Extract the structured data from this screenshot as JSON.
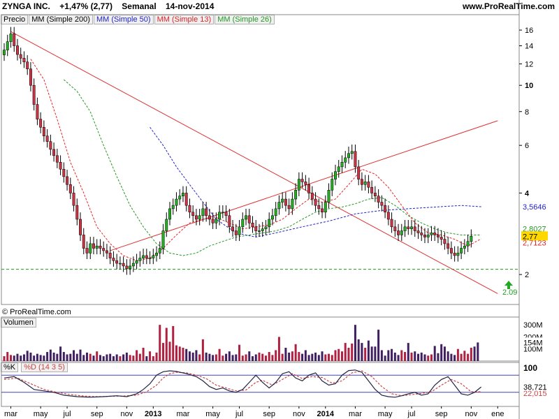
{
  "header": {
    "ticker": "ZYNGA INC.",
    "change": "+1,47% (2,77)",
    "period": "Semanal",
    "date": "14-nov-2014",
    "site": "www.ProRealTime.com"
  },
  "copyright": "© ProRealTime.com",
  "legend": {
    "price": "Precio",
    "ma200": "MM (Simple 200)",
    "ma50": "MM (Simple 50)",
    "ma13": "MM (Simple 13)",
    "ma26": "MM (Simple 26)"
  },
  "volume_title": "Volumen",
  "stoch_titles": {
    "k": "%K",
    "d": "%D (14 3 5)"
  },
  "colors": {
    "up": "#22b022",
    "down": "#cc3344",
    "ma50": "#2222cc",
    "ma13": "#ee2222",
    "ma26": "#229922",
    "trendline": "#dd3333",
    "vol_up": "#b02040",
    "vol_down": "#402060",
    "stoch_k": "#222244",
    "stoch_d": "#cc4444"
  },
  "chart_data": {
    "type": "candlestick",
    "price_axis": {
      "ticks": [
        2,
        4,
        6,
        8,
        10,
        12,
        14,
        16
      ],
      "bold_ticks": [
        10,
        4
      ],
      "scale": "log"
    },
    "price_labels": {
      "last": "2,77",
      "ma50": "3,5646",
      "ma26": "2,8027",
      "ma13": "2,7123",
      "support": "2.09"
    },
    "support_level": 2.09,
    "x_labels": [
      "mar",
      "may",
      "jul",
      "sep",
      "nov",
      "2013",
      "mar",
      "may",
      "jul",
      "sep",
      "nov",
      "2014",
      "mar",
      "may",
      "jul",
      "sep",
      "nov",
      "ene"
    ],
    "x_label_weeks": [
      2,
      11,
      19,
      28,
      37,
      45,
      54,
      63,
      71,
      80,
      89,
      97,
      106,
      115,
      123,
      132,
      141,
      149
    ],
    "start_label": "mar",
    "closes": [
      13.5,
      14.5,
      15.5,
      14,
      13,
      12.6,
      12.2,
      11.5,
      10,
      8.5,
      7.5,
      7,
      6.5,
      6.2,
      5.8,
      5.5,
      5.2,
      4.9,
      4.6,
      4.3,
      4,
      3.6,
      3.2,
      2.8,
      2.5,
      2.4,
      2.6,
      2.5,
      2.55,
      2.5,
      2.45,
      2.4,
      2.3,
      2.25,
      2.2,
      2.2,
      2.15,
      2.1,
      2.15,
      2.2,
      2.25,
      2.3,
      2.35,
      2.3,
      2.3,
      2.35,
      2.4,
      2.5,
      2.9,
      3.2,
      3.5,
      3.6,
      3.8,
      3.9,
      4.0,
      3.6,
      3.4,
      3.3,
      3.2,
      3.3,
      3.5,
      3.3,
      3.2,
      3.1,
      3.2,
      3.4,
      3.4,
      3.3,
      3.0,
      2.9,
      2.8,
      3.0,
      3.2,
      3.3,
      3.1,
      3.0,
      2.9,
      2.9,
      2.95,
      3.0,
      3.2,
      3.3,
      3.5,
      3.7,
      3.8,
      3.6,
      3.5,
      3.8,
      4.1,
      4.5,
      4.4,
      4.3,
      4.0,
      3.8,
      3.6,
      3.5,
      3.4,
      3.7,
      4.1,
      4.5,
      4.8,
      5.0,
      5.2,
      5.4,
      5.6,
      5.7,
      5.0,
      4.5,
      4.3,
      4.4,
      4.2,
      4.0,
      3.9,
      3.7,
      3.6,
      3.4,
      3.2,
      3.0,
      2.9,
      2.8,
      2.9,
      3.0,
      2.95,
      3.0,
      2.9,
      2.85,
      2.8,
      2.75,
      2.8,
      2.85,
      2.8,
      2.75,
      2.7,
      2.6,
      2.5,
      2.4,
      2.35,
      2.4,
      2.5,
      2.55,
      2.65,
      2.77
    ],
    "ma50_label": "MM (Simple 50)",
    "ma50": [
      [
        44,
        7.0
      ],
      [
        48,
        6.0
      ],
      [
        52,
        5.0
      ],
      [
        56,
        4.3
      ],
      [
        60,
        3.7
      ],
      [
        64,
        3.2
      ],
      [
        70,
        2.85
      ],
      [
        76,
        2.75
      ],
      [
        82,
        2.85
      ],
      [
        90,
        3.0
      ],
      [
        98,
        3.15
      ],
      [
        106,
        3.35
      ],
      [
        114,
        3.45
      ],
      [
        122,
        3.5
      ],
      [
        130,
        3.55
      ],
      [
        138,
        3.6
      ],
      [
        144,
        3.56
      ]
    ],
    "ma26_label": "MM (Simple 26)",
    "ma26": [
      [
        18,
        10.5
      ],
      [
        22,
        9.5
      ],
      [
        26,
        8.0
      ],
      [
        30,
        6.0
      ],
      [
        34,
        4.6
      ],
      [
        38,
        3.6
      ],
      [
        42,
        3.0
      ],
      [
        46,
        2.6
      ],
      [
        50,
        2.4
      ],
      [
        54,
        2.35
      ],
      [
        58,
        2.4
      ],
      [
        62,
        2.55
      ],
      [
        66,
        2.65
      ],
      [
        70,
        2.75
      ],
      [
        74,
        2.8
      ],
      [
        78,
        2.85
      ],
      [
        82,
        2.9
      ],
      [
        86,
        3.0
      ],
      [
        90,
        3.2
      ],
      [
        94,
        3.4
      ],
      [
        98,
        3.5
      ],
      [
        102,
        3.55
      ],
      [
        106,
        3.65
      ],
      [
        110,
        3.8
      ],
      [
        114,
        3.85
      ],
      [
        118,
        3.6
      ],
      [
        122,
        3.3
      ],
      [
        126,
        3.1
      ],
      [
        130,
        2.95
      ],
      [
        134,
        2.85
      ],
      [
        138,
        2.8
      ],
      [
        144,
        2.8
      ]
    ],
    "ma13_label": "MM (Simple 13)",
    "ma13": [
      [
        8,
        12.5
      ],
      [
        12,
        10.5
      ],
      [
        16,
        7.5
      ],
      [
        20,
        5.2
      ],
      [
        24,
        4.0
      ],
      [
        28,
        3.0
      ],
      [
        32,
        2.6
      ],
      [
        36,
        2.35
      ],
      [
        40,
        2.25
      ],
      [
        44,
        2.3
      ],
      [
        48,
        2.5
      ],
      [
        52,
        2.8
      ],
      [
        56,
        3.1
      ],
      [
        60,
        3.2
      ],
      [
        64,
        3.25
      ],
      [
        68,
        3.1
      ],
      [
        72,
        2.95
      ],
      [
        76,
        3.0
      ],
      [
        80,
        3.05
      ],
      [
        84,
        3.2
      ],
      [
        88,
        3.5
      ],
      [
        92,
        3.8
      ],
      [
        96,
        3.7
      ],
      [
        100,
        3.8
      ],
      [
        104,
        4.3
      ],
      [
        108,
        4.9
      ],
      [
        112,
        4.7
      ],
      [
        116,
        4.2
      ],
      [
        120,
        3.6
      ],
      [
        124,
        3.1
      ],
      [
        128,
        2.85
      ],
      [
        132,
        2.8
      ],
      [
        136,
        2.7
      ],
      [
        140,
        2.55
      ],
      [
        144,
        2.71
      ]
    ],
    "trendlines": [
      {
        "from": [
          2,
          15.8
        ],
        "to": [
          149,
          1.7
        ]
      },
      {
        "from": [
          32,
          2.45
        ],
        "to": [
          149,
          7.4
        ]
      }
    ],
    "volume_axis": {
      "ticks": [
        "300M",
        "200M",
        "100M"
      ]
    },
    "volume_last_label": "154M",
    "volumes_m": [
      40,
      75,
      50,
      45,
      60,
      45,
      55,
      85,
      70,
      45,
      60,
      50,
      45,
      75,
      95,
      70,
      60,
      120,
      75,
      55,
      60,
      90,
      60,
      95,
      50,
      70,
      60,
      45,
      80,
      50,
      40,
      55,
      60,
      40,
      55,
      40,
      55,
      70,
      50,
      45,
      90,
      60,
      110,
      40,
      80,
      40,
      70,
      300,
      150,
      275,
      160,
      290,
      130,
      120,
      110,
      100,
      80,
      70,
      90,
      55,
      180,
      70,
      60,
      50,
      55,
      100,
      45,
      60,
      80,
      50,
      55,
      135,
      45,
      55,
      80,
      40,
      55,
      70,
      60,
      45,
      75,
      50,
      90,
      200,
      60,
      110,
      70,
      80,
      140,
      75,
      60,
      90,
      50,
      60,
      70,
      50,
      80,
      55,
      60,
      50,
      90,
      100,
      80,
      150,
      110,
      145,
      300,
      180,
      150,
      110,
      170,
      120,
      120,
      260,
      90,
      45,
      90,
      100,
      70,
      50,
      90,
      75,
      150,
      70,
      80,
      60,
      70,
      55,
      45,
      55,
      125,
      65,
      140,
      120,
      80,
      60,
      50,
      100,
      60,
      85,
      60,
      110,
      120,
      154
    ],
    "stoch_axis": {
      "ticks": [
        100
      ]
    },
    "stoch_labels": {
      "k": "38,721",
      "d": "22,015"
    },
    "stoch_levels": [
      80,
      20
    ],
    "stoch_k": [
      [
        0,
        70
      ],
      [
        3,
        75
      ],
      [
        6,
        55
      ],
      [
        9,
        30
      ],
      [
        12,
        25
      ],
      [
        15,
        20
      ],
      [
        18,
        10
      ],
      [
        22,
        5
      ],
      [
        26,
        3
      ],
      [
        30,
        5
      ],
      [
        34,
        8
      ],
      [
        37,
        5
      ],
      [
        40,
        15
      ],
      [
        42,
        30
      ],
      [
        44,
        50
      ],
      [
        46,
        80
      ],
      [
        48,
        92
      ],
      [
        50,
        95
      ],
      [
        52,
        93
      ],
      [
        55,
        85
      ],
      [
        58,
        75
      ],
      [
        60,
        60
      ],
      [
        62,
        40
      ],
      [
        64,
        30
      ],
      [
        66,
        35
      ],
      [
        68,
        25
      ],
      [
        70,
        20
      ],
      [
        72,
        30
      ],
      [
        74,
        55
      ],
      [
        76,
        80
      ],
      [
        78,
        55
      ],
      [
        80,
        35
      ],
      [
        82,
        55
      ],
      [
        84,
        85
      ],
      [
        86,
        92
      ],
      [
        88,
        70
      ],
      [
        90,
        60
      ],
      [
        92,
        80
      ],
      [
        94,
        88
      ],
      [
        96,
        60
      ],
      [
        98,
        45
      ],
      [
        100,
        50
      ],
      [
        102,
        80
      ],
      [
        104,
        96
      ],
      [
        106,
        98
      ],
      [
        108,
        90
      ],
      [
        110,
        60
      ],
      [
        112,
        30
      ],
      [
        114,
        10
      ],
      [
        116,
        5
      ],
      [
        118,
        3
      ],
      [
        120,
        8
      ],
      [
        122,
        15
      ],
      [
        124,
        20
      ],
      [
        126,
        10
      ],
      [
        128,
        15
      ],
      [
        130,
        45
      ],
      [
        132,
        65
      ],
      [
        134,
        75
      ],
      [
        136,
        45
      ],
      [
        138,
        15
      ],
      [
        140,
        10
      ],
      [
        142,
        20
      ],
      [
        144,
        38.7
      ]
    ],
    "stoch_d": [
      [
        0,
        65
      ],
      [
        4,
        70
      ],
      [
        8,
        50
      ],
      [
        12,
        30
      ],
      [
        16,
        20
      ],
      [
        20,
        12
      ],
      [
        24,
        7
      ],
      [
        28,
        5
      ],
      [
        32,
        6
      ],
      [
        36,
        7
      ],
      [
        40,
        10
      ],
      [
        43,
        22
      ],
      [
        46,
        45
      ],
      [
        48,
        70
      ],
      [
        50,
        85
      ],
      [
        52,
        90
      ],
      [
        55,
        88
      ],
      [
        58,
        80
      ],
      [
        61,
        68
      ],
      [
        64,
        45
      ],
      [
        67,
        35
      ],
      [
        70,
        25
      ],
      [
        73,
        28
      ],
      [
        76,
        55
      ],
      [
        78,
        62
      ],
      [
        81,
        45
      ],
      [
        84,
        65
      ],
      [
        87,
        85
      ],
      [
        90,
        68
      ],
      [
        93,
        75
      ],
      [
        96,
        72
      ],
      [
        99,
        52
      ],
      [
        102,
        60
      ],
      [
        105,
        88
      ],
      [
        108,
        95
      ],
      [
        111,
        75
      ],
      [
        114,
        40
      ],
      [
        117,
        15
      ],
      [
        120,
        8
      ],
      [
        123,
        12
      ],
      [
        126,
        16
      ],
      [
        129,
        22
      ],
      [
        132,
        45
      ],
      [
        135,
        65
      ],
      [
        138,
        50
      ],
      [
        141,
        22
      ],
      [
        144,
        22
      ]
    ]
  }
}
